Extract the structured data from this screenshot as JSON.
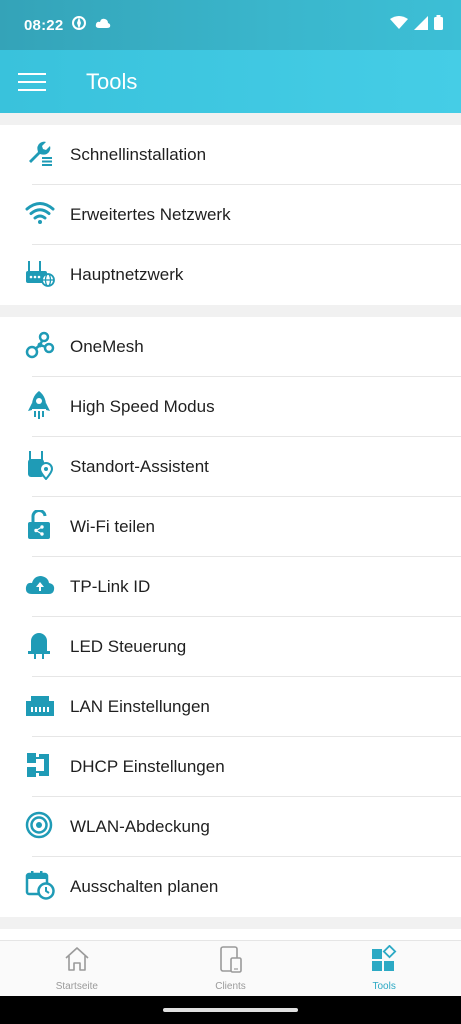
{
  "status_bar": {
    "time": "08:22"
  },
  "app_bar": {
    "title": "Tools"
  },
  "sections": [
    {
      "items": [
        {
          "label": "Schnellinstallation",
          "icon": "wrench-icon"
        },
        {
          "label": "Erweitertes Netzwerk",
          "icon": "wifi-icon"
        },
        {
          "label": "Hauptnetzwerk",
          "icon": "router-globe-icon"
        }
      ]
    },
    {
      "items": [
        {
          "label": "OneMesh",
          "icon": "mesh-nodes-icon"
        },
        {
          "label": "High Speed Modus",
          "icon": "rocket-icon"
        },
        {
          "label": "Standort-Assistent",
          "icon": "device-location-icon"
        },
        {
          "label": "Wi-Fi teilen",
          "icon": "unlock-share-icon"
        },
        {
          "label": "TP-Link ID",
          "icon": "cloud-upload-icon"
        },
        {
          "label": "LED Steuerung",
          "icon": "led-icon"
        },
        {
          "label": "LAN Einstellungen",
          "icon": "ethernet-port-icon"
        },
        {
          "label": "DHCP Einstellungen",
          "icon": "dhcp-icon"
        },
        {
          "label": "WLAN-Abdeckung",
          "icon": "coverage-icon"
        },
        {
          "label": "Ausschalten planen",
          "icon": "calendar-clock-icon"
        }
      ]
    }
  ],
  "bottom_nav": [
    {
      "label": "Startseite",
      "icon": "home-icon",
      "active": false
    },
    {
      "label": "Clients",
      "icon": "devices-icon",
      "active": false
    },
    {
      "label": "Tools",
      "icon": "tools-grid-icon",
      "active": true
    }
  ],
  "colors": {
    "accent": "#2ca9c4",
    "app_bar": "#3fc5de",
    "status_bar": "#36a9be",
    "icon": "#1f9bb6"
  }
}
